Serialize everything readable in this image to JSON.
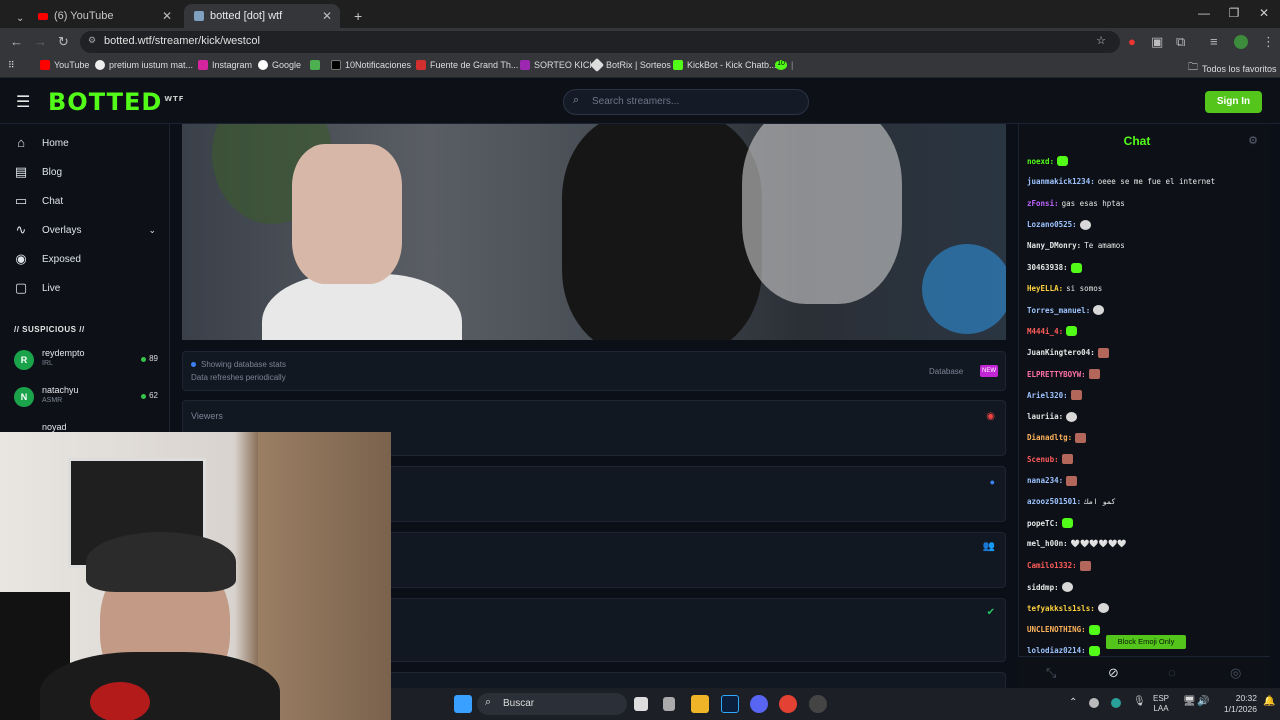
{
  "browser": {
    "tabs": [
      {
        "title": "(6) YouTube",
        "active": false
      },
      {
        "title": "botted [dot] wtf",
        "active": true
      }
    ],
    "url": "botted.wtf/streamer/kick/westcol",
    "bookmarks": [
      "YouTube",
      "pretium iustum mat...",
      "Instagram",
      "Google",
      "10Notificaciones",
      "Fuente de Grand Th...",
      "SORTEO KICK",
      "BotRix | Sorteos",
      "KickBot - Kick Chatb...",
      "10",
      "Todos los favoritos"
    ]
  },
  "site": {
    "logo": "BOTTED",
    "logo_sup": "WTF",
    "search_placeholder": "Search streamers...",
    "signin": "Sign In"
  },
  "sidebar": {
    "items": [
      {
        "label": "Home",
        "icon": "home-icon"
      },
      {
        "label": "Blog",
        "icon": "blog-icon"
      },
      {
        "label": "Chat",
        "icon": "chat-icon"
      },
      {
        "label": "Overlays",
        "icon": "overlays-icon"
      },
      {
        "label": "Exposed",
        "icon": "eye-icon"
      },
      {
        "label": "Live",
        "icon": "tv-icon"
      }
    ],
    "section_title": "// SUSPICIOUS //",
    "streamers": [
      {
        "initial": "R",
        "name": "reydempto",
        "category": "IRL",
        "count": "89"
      },
      {
        "initial": "N",
        "name": "natachyu",
        "category": "ASMR",
        "count": "62"
      },
      {
        "initial": "N",
        "name": "noyad",
        "category": "",
        "count": ""
      }
    ]
  },
  "main": {
    "stats_note": "Showing database stats",
    "stats_sub": "Data refreshes periodically",
    "database_label": "Database",
    "new_badge": "NEW",
    "viewers_label": "Viewers"
  },
  "chat": {
    "title": "Chat",
    "messages": [
      {
        "user": "noexd:",
        "color": "#53fc18",
        "text": "",
        "emote": "g"
      },
      {
        "user": "juanmakick1234:",
        "color": "#9ec3ff",
        "text": "oeee se me fue el internet",
        "emote": ""
      },
      {
        "user": "zFonsi:",
        "color": "#c065ff",
        "text": "gas esas hptas",
        "emote": ""
      },
      {
        "user": "Lozano0525:",
        "color": "#9ec3ff",
        "text": "",
        "emote": "s"
      },
      {
        "user": "Nany_DMonry:",
        "color": "#e5e5e5",
        "text": "Te amamos",
        "emote": ""
      },
      {
        "user": "30463938:",
        "color": "#e5e5e5",
        "text": "",
        "emote": "g"
      },
      {
        "user": "HeyELLA:",
        "color": "#ffd23f",
        "text": "si somos",
        "emote": ""
      },
      {
        "user": "Torres_manuel:",
        "color": "#9ec3ff",
        "text": "",
        "emote": "s"
      },
      {
        "user": "M444i_4:",
        "color": "#ff5b5b",
        "text": "",
        "emote": "g"
      },
      {
        "user": "JuanKingtero04:",
        "color": "#e5e5e5",
        "text": "",
        "emote": "p"
      },
      {
        "user": "ELPRETTYBOYW:",
        "color": "#ff6fa3",
        "text": "",
        "emote": "p"
      },
      {
        "user": "Ariel320:",
        "color": "#9ec3ff",
        "text": "",
        "emote": "p"
      },
      {
        "user": "lauriia:",
        "color": "#e5e5e5",
        "text": "",
        "emote": "s"
      },
      {
        "user": "Dianadltg:",
        "color": "#ffb35c",
        "text": "",
        "emote": "p"
      },
      {
        "user": "Scenub:",
        "color": "#ff5b5b",
        "text": "",
        "emote": "p"
      },
      {
        "user": "nana234:",
        "color": "#9ec3ff",
        "text": "",
        "emote": "p"
      },
      {
        "user": "azooz501501:",
        "color": "#9ec3ff",
        "text": "كمو امك",
        "emote": ""
      },
      {
        "user": "popeTC:",
        "color": "#e5e5e5",
        "text": "",
        "emote": "g"
      },
      {
        "user": "mel_h00n:",
        "color": "#e5e5e5",
        "text": "🤍🤍🤍🤍🤍🤍",
        "emote": ""
      },
      {
        "user": "Camilo1332:",
        "color": "#ff5b5b",
        "text": "",
        "emote": "p"
      },
      {
        "user": "siddmp:",
        "color": "#e5e5e5",
        "text": "",
        "emote": "s"
      },
      {
        "user": "tefyakksls1sls:",
        "color": "#ffd23f",
        "text": "",
        "emote": "s"
      },
      {
        "user": "UNCLENOTHING:",
        "color": "#ffb35c",
        "text": "",
        "emote": "g"
      },
      {
        "user": "lolodiaz0214:",
        "color": "#9ec3ff",
        "text": "",
        "emote": "g"
      }
    ],
    "tooltip": "Block Emoji Only"
  },
  "taskbar": {
    "search": "Buscar",
    "lang": "ESP",
    "lang2": "LAA",
    "time": "20:32",
    "date": "1/1/2026"
  }
}
